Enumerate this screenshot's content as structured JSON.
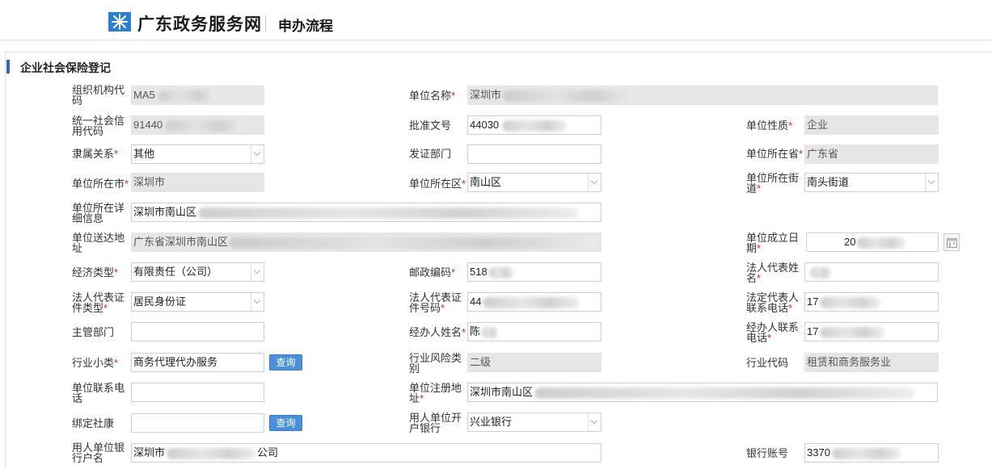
{
  "header": {
    "brand": "广东政务服务网",
    "subtitle": "申办流程"
  },
  "section": {
    "title": "企业社会保险登记"
  },
  "form": {
    "org_code": {
      "label": "组织机构代码",
      "value": "MA5"
    },
    "unit_name": {
      "label": "单位名称",
      "value": "深圳市"
    },
    "credit_code": {
      "label": "统一社会信用代码",
      "value": "91440"
    },
    "approval_no": {
      "label": "批准文号",
      "value": "44030"
    },
    "unit_nature": {
      "label": "单位性质",
      "value": "企业"
    },
    "affiliation": {
      "label": "隶属关系",
      "value": "其他"
    },
    "issuing_dept": {
      "label": "发证部门",
      "value": ""
    },
    "province": {
      "label": "单位所在省",
      "value": "广东省"
    },
    "city": {
      "label": "单位所在市",
      "value": "深圳市"
    },
    "district": {
      "label": "单位所在区",
      "value": "南山区"
    },
    "street": {
      "label": "单位所在街道",
      "value": "南头街道"
    },
    "detail_addr": {
      "label": "单位所在详细信息",
      "value": "深圳市南山区"
    },
    "delivery_addr": {
      "label": "单位送达地址",
      "value": "广东省深圳市南山区"
    },
    "found_date": {
      "label": "单位成立日期",
      "value": "20"
    },
    "econ_type": {
      "label": "经济类型",
      "value": "有限责任（公司）"
    },
    "postcode": {
      "label": "邮政编码",
      "value": "518"
    },
    "legal_name": {
      "label": "法人代表姓名",
      "value": ""
    },
    "legal_id_type": {
      "label": "法人代表证件类型",
      "value": "居民身份证"
    },
    "legal_id_no": {
      "label": "法人代表证件号码",
      "value": "44"
    },
    "legal_phone": {
      "label": "法定代表人联系电话",
      "value": "17"
    },
    "supervisor": {
      "label": "主管部门",
      "value": ""
    },
    "agent_name": {
      "label": "经办人姓名",
      "value": "陈"
    },
    "agent_phone": {
      "label": "经办人联系电话",
      "value": "17"
    },
    "industry_sub": {
      "label": "行业小类",
      "value": "商务代理代办服务"
    },
    "industry_risk": {
      "label": "行业风险类别",
      "value": "二级"
    },
    "industry_code": {
      "label": "行业代码",
      "value": "租赁和商务服务业"
    },
    "unit_phone": {
      "label": "单位联系电话",
      "value": ""
    },
    "reg_addr": {
      "label": "单位注册地址",
      "value": "深圳市南山区"
    },
    "bind_shekang": {
      "label": "绑定社康",
      "value": ""
    },
    "bank": {
      "label": "用人单位开户银行",
      "value": "兴业银行"
    },
    "account_name": {
      "label": "用人单位银行户名",
      "value_prefix": "深圳市",
      "value_suffix": "公司"
    },
    "account_no": {
      "label": "银行账号",
      "value": "3370"
    },
    "query_label": "查询"
  }
}
